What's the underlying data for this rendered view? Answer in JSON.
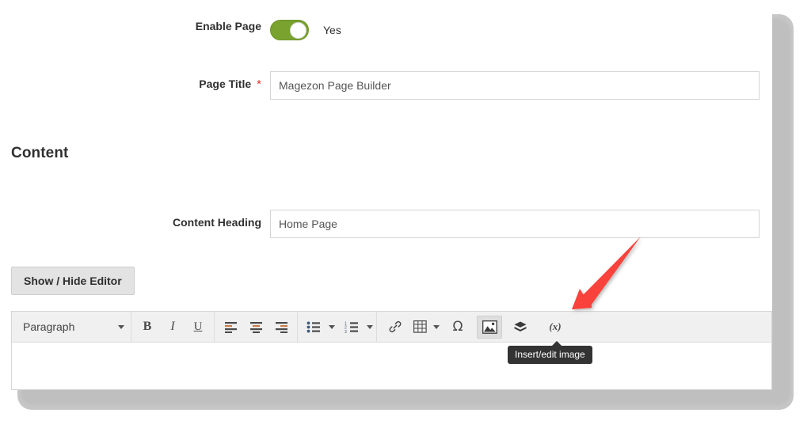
{
  "form": {
    "enable_page": {
      "label": "Enable Page",
      "toggle_state": "on",
      "value_text": "Yes",
      "toggle_color": "#79a22e"
    },
    "page_title": {
      "label": "Page Title",
      "required_marker": "*",
      "value": "Magezon Page Builder",
      "placeholder": ""
    }
  },
  "content_section": {
    "title": "Content",
    "content_heading": {
      "label": "Content Heading",
      "value": "Home Page",
      "placeholder": ""
    },
    "show_hide_editor_button": "Show / Hide Editor"
  },
  "editor": {
    "format_select": {
      "selected": "Paragraph",
      "icon": "chevron-down-icon"
    },
    "toolbar_groups": [
      {
        "name": "format-group",
        "buttons": [
          {
            "name": "bold-button",
            "label": "B",
            "icon": "bold-icon",
            "active": false
          },
          {
            "name": "italic-button",
            "label": "I",
            "icon": "italic-icon",
            "active": false
          },
          {
            "name": "underline-button",
            "label": "U",
            "icon": "underline-icon",
            "active": false
          }
        ]
      },
      {
        "name": "align-group",
        "buttons": [
          {
            "name": "align-left-button",
            "label": "",
            "icon": "align-left-icon",
            "active": false
          },
          {
            "name": "align-center-button",
            "label": "",
            "icon": "align-center-icon",
            "active": false
          },
          {
            "name": "align-right-button",
            "label": "",
            "icon": "align-right-icon",
            "active": false
          }
        ]
      },
      {
        "name": "list-group",
        "buttons": [
          {
            "name": "bullet-list-button",
            "label": "",
            "icon": "bullet-list-icon",
            "active": false
          },
          {
            "name": "numbered-list-button",
            "label": "",
            "icon": "numbered-list-icon",
            "active": false
          }
        ]
      },
      {
        "name": "insert-group",
        "buttons": [
          {
            "name": "insert-link-button",
            "label": "",
            "icon": "link-icon",
            "active": false
          },
          {
            "name": "insert-table-button",
            "label": "",
            "icon": "table-icon",
            "active": false
          },
          {
            "name": "special-character-button",
            "label": "Ω",
            "icon": "omega-icon",
            "active": false
          },
          {
            "name": "insert-edit-image-button",
            "label": "",
            "icon": "image-icon",
            "active": true
          },
          {
            "name": "insert-widget-button",
            "label": "",
            "icon": "widget-layers-icon",
            "active": false
          },
          {
            "name": "insert-variable-button",
            "label": "(x)",
            "icon": "variable-icon",
            "active": false
          }
        ]
      }
    ],
    "body_text": ""
  },
  "tooltip": {
    "text": "Insert/edit image",
    "background": "#333333"
  },
  "annotation": {
    "arrow_color": "#f9423a",
    "points_to": "insert-edit-image-button"
  }
}
